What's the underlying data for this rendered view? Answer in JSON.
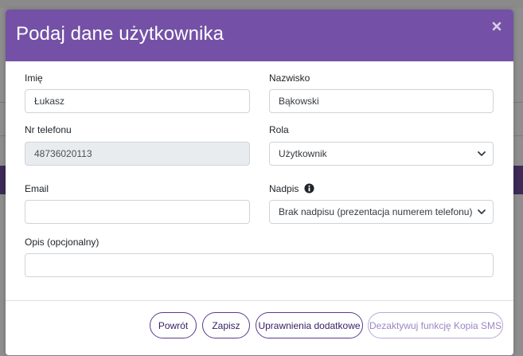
{
  "modal": {
    "title": "Podaj dane użytkownika",
    "close_icon": "close-icon"
  },
  "form": {
    "first_name": {
      "label": "Imię",
      "value": "Łukasz"
    },
    "last_name": {
      "label": "Nazwisko",
      "value": "Bąkowski"
    },
    "phone": {
      "label": "Nr telefonu",
      "value": "48736020113",
      "disabled": true
    },
    "role": {
      "label": "Rola",
      "selected": "Użytkownik"
    },
    "email": {
      "label": "Email",
      "value": ""
    },
    "caption": {
      "label": "Nadpis",
      "selected": "Brak nadpisu (prezentacja numerem telefonu)",
      "info_icon": "info-icon"
    },
    "description": {
      "label": "Opis (opcjonalny)",
      "value": ""
    }
  },
  "footer": {
    "back_label": "Powrót",
    "save_label": "Zapisz",
    "permissions_label": "Uprawnienia dodatkowe",
    "deactivate_label": "Dezaktywuj funkcję Kopia SMS"
  },
  "colors": {
    "header": "#7451a6",
    "button_border": "#5b3a8c",
    "overlay": "#8e8e8e"
  }
}
